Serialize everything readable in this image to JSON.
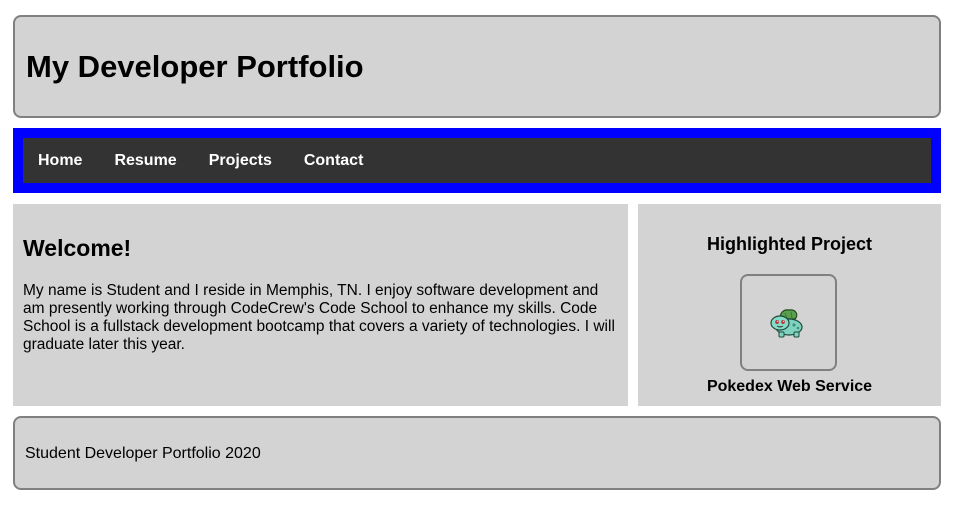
{
  "header": {
    "title": "My Developer Portfolio"
  },
  "nav": {
    "items": [
      {
        "label": "Home"
      },
      {
        "label": "Resume"
      },
      {
        "label": "Projects"
      },
      {
        "label": "Contact"
      }
    ],
    "colors": {
      "outer": "#0000ff",
      "inner": "#333333",
      "text": "#ffffff"
    }
  },
  "welcome": {
    "heading": "Welcome!",
    "body": "My name is Student and I reside in Memphis, TN. I enjoy software development and am presently working through CodeCrew's Code School to enhance my skills. Code School is a fullstack development bootcamp that covers a variety of technologies. I will graduate later this year."
  },
  "highlight": {
    "heading": "Highlighted Project",
    "project_name": "Pokedex Web Service",
    "image_icon": "bulbasaur-sprite-icon"
  },
  "footer": {
    "text": "Student Developer Portfolio 2020"
  },
  "colors": {
    "panel": "#d3d3d3",
    "border": "#808080"
  }
}
